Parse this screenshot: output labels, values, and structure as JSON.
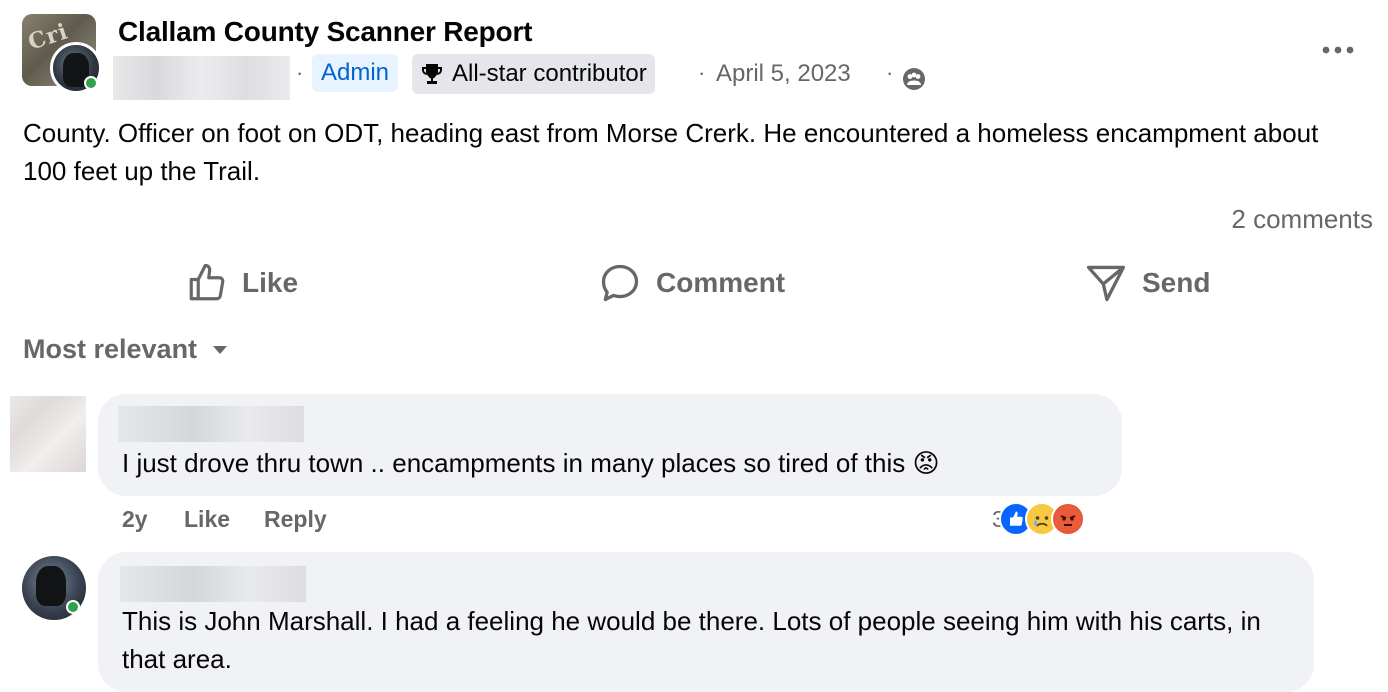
{
  "post": {
    "group_name": "Clallam County Scanner Report",
    "admin_badge": "Admin",
    "contributor_badge": "All-star contributor",
    "date": "April 5, 2023",
    "separator": "·",
    "body": "County. Officer on foot on ODT, heading east from Morse Crerk.  He encountered a homeless encampment  about 100 feet up the Trail.",
    "comment_count": "2 comments",
    "more_icon": "more-horizontal-icon",
    "audience_icon": "group-audience-icon"
  },
  "actions": {
    "like": "Like",
    "comment": "Comment",
    "send": "Send"
  },
  "sort": {
    "label": "Most relevant"
  },
  "comments": [
    {
      "text": "I just drove thru town .. encampments in many places so tired of this 😡",
      "age": "2y",
      "like": "Like",
      "reply": "Reply",
      "reaction_count": "3",
      "reactions": [
        "like",
        "sad",
        "angry"
      ]
    },
    {
      "text": "This is John Marshall. I had a feeling he would be there. Lots of people seeing him with his carts, in that area."
    }
  ],
  "colors": {
    "accent_blue": "#0866ff",
    "online_green": "#31a24c",
    "muted_text": "#65676b",
    "bubble_bg": "#f0f2f5"
  }
}
